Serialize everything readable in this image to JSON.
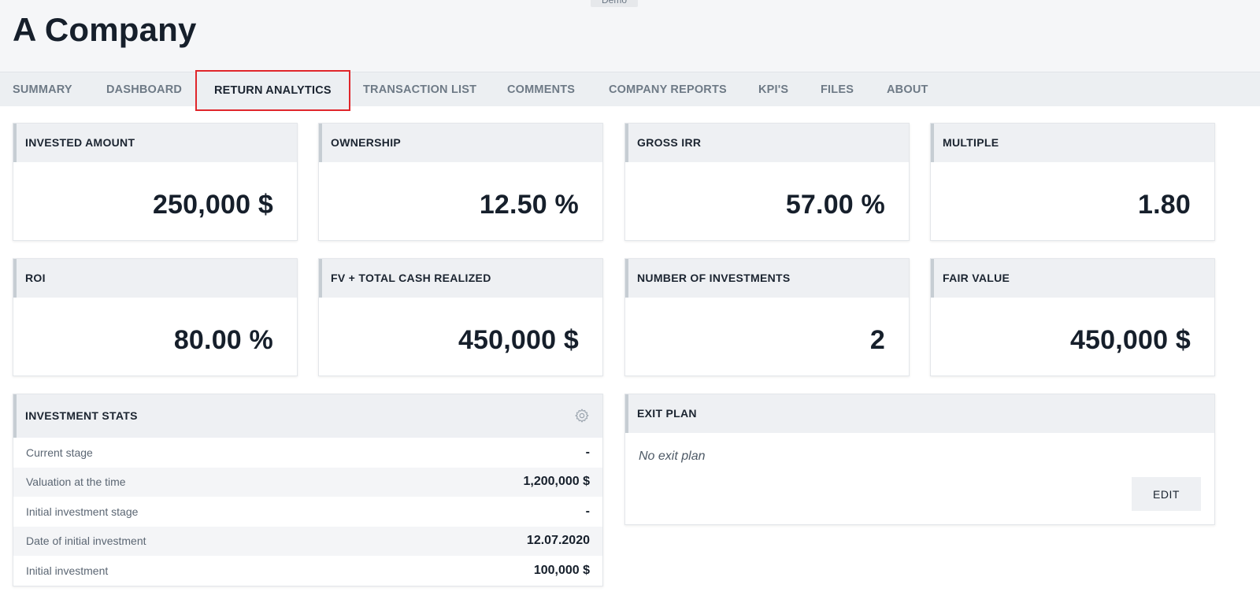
{
  "header": {
    "badge": "Demo",
    "title": "A Company"
  },
  "tabs": [
    {
      "label": "SUMMARY"
    },
    {
      "label": "DASHBOARD"
    },
    {
      "label": "RETURN ANALYTICS"
    },
    {
      "label": "TRANSACTION LIST"
    },
    {
      "label": "COMMENTS"
    },
    {
      "label": "COMPANY REPORTS"
    },
    {
      "label": "KPI'S"
    },
    {
      "label": "FILES"
    },
    {
      "label": "ABOUT"
    }
  ],
  "active_tab": "RETURN ANALYTICS",
  "metrics": [
    {
      "label": "INVESTED AMOUNT",
      "value": "250,000 $"
    },
    {
      "label": "OWNERSHIP",
      "value": "12.50 %"
    },
    {
      "label": "GROSS IRR",
      "value": "57.00 %"
    },
    {
      "label": "MULTIPLE",
      "value": "1.80"
    },
    {
      "label": "ROI",
      "value": "80.00 %"
    },
    {
      "label": "FV + TOTAL CASH REALIZED",
      "value": "450,000 $"
    },
    {
      "label": "NUMBER OF INVESTMENTS",
      "value": "2"
    },
    {
      "label": "FAIR VALUE",
      "value": "450,000 $"
    }
  ],
  "investment_stats": {
    "title": "INVESTMENT STATS",
    "rows": [
      {
        "label": "Current stage",
        "value": "-"
      },
      {
        "label": "Valuation at the time",
        "value": "1,200,000 $"
      },
      {
        "label": "Initial investment stage",
        "value": "-"
      },
      {
        "label": "Date of initial investment",
        "value": "12.07.2020"
      },
      {
        "label": "Initial investment",
        "value": "100,000 $"
      }
    ]
  },
  "exit_plan": {
    "title": "EXIT PLAN",
    "empty_text": "No exit plan",
    "edit_label": "EDIT"
  },
  "colors": {
    "active_tab_outline": "#e0262b",
    "accent_bar": "#c6cdd3"
  }
}
